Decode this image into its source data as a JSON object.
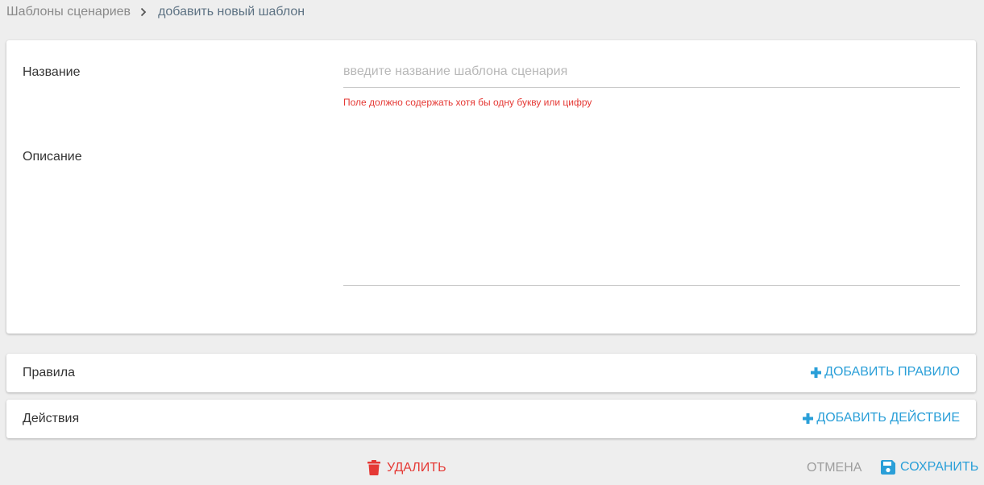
{
  "breadcrumb": {
    "root": "Шаблоны сценариев",
    "current": "добавить новый шаблон"
  },
  "form": {
    "name_label": "Название",
    "name_value": "",
    "name_placeholder": "введите название шаблона сценария",
    "name_error": "Поле должно содержать хотя бы одну букву или цифру",
    "description_label": "Описание",
    "description_value": ""
  },
  "rules": {
    "title": "Правила",
    "add_label": "ДОБАВИТЬ ПРАВИЛО"
  },
  "actions": {
    "title": "Действия",
    "add_label": "ДОБАВИТЬ ДЕЙСТВИЕ"
  },
  "footer": {
    "delete_label": "УДАЛИТЬ",
    "cancel_label": "ОТМЕНА",
    "save_label": "СОХРАНИТЬ"
  },
  "icons": {
    "breadcrumb_separator": "chevron-right-icon",
    "add": "plus-icon",
    "delete": "trash-icon",
    "save": "floppy-disk-icon"
  },
  "colors": {
    "accent": "#2a9fd8",
    "danger": "#e53935",
    "muted": "#9e9e9e"
  }
}
